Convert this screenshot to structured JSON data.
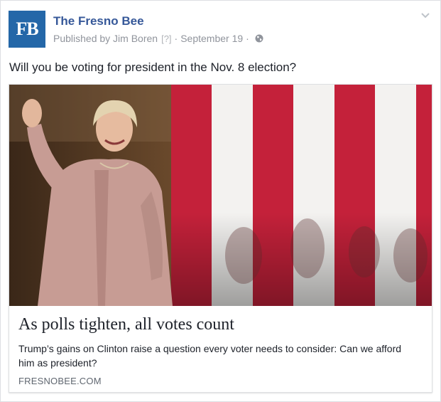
{
  "post": {
    "page_name": "The Fresno Bee",
    "logo_text": "FB",
    "published_by": "Published by Jim Boren",
    "help_marker": "[?]",
    "separator": "·",
    "date": "September 19",
    "privacy_icon": "globe-icon",
    "menu_icon": "chevron-down-icon",
    "text": "Will you be voting for president in the Nov. 8 election?"
  },
  "link_preview": {
    "title": "As polls tighten, all votes count",
    "description": "Trump’s gains on Clinton raise a question every voter needs to consider: Can we afford him as president?",
    "domain": "FRESNOBEE.COM"
  },
  "colors": {
    "logo_bg": "#2467a8",
    "page_name": "#365899",
    "meta_text": "#90949c",
    "flag_red": "#c4213a"
  }
}
